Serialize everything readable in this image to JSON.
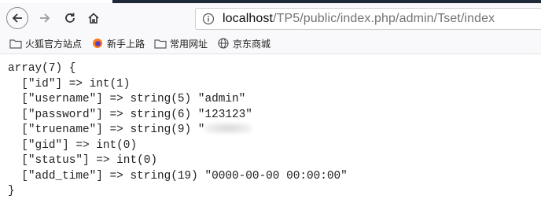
{
  "browser": {
    "url_host": "localhost",
    "url_path": "/TP5/public/index.php/admin/Tset/index",
    "bookmarks": [
      {
        "icon": "folder-icon",
        "label": "火狐官方站点"
      },
      {
        "icon": "firefox-icon",
        "label": "新手上路"
      },
      {
        "icon": "folder-icon",
        "label": "常用网址"
      },
      {
        "icon": "globe-icon",
        "label": "京东商城"
      }
    ]
  },
  "dump": {
    "header": "array(7) {",
    "rows": [
      "  [\"id\"] => int(1)",
      "  [\"username\"] => string(5) \"admin\"",
      "  [\"password\"] => string(6) \"123123\"",
      "  [\"truename\"] => string(9) \"",
      "  [\"gid\"] => int(0)",
      "  [\"status\"] => int(0)",
      "  [\"add_time\"] => string(19) \"0000-00-00 00:00:00\""
    ],
    "footer": "}"
  }
}
